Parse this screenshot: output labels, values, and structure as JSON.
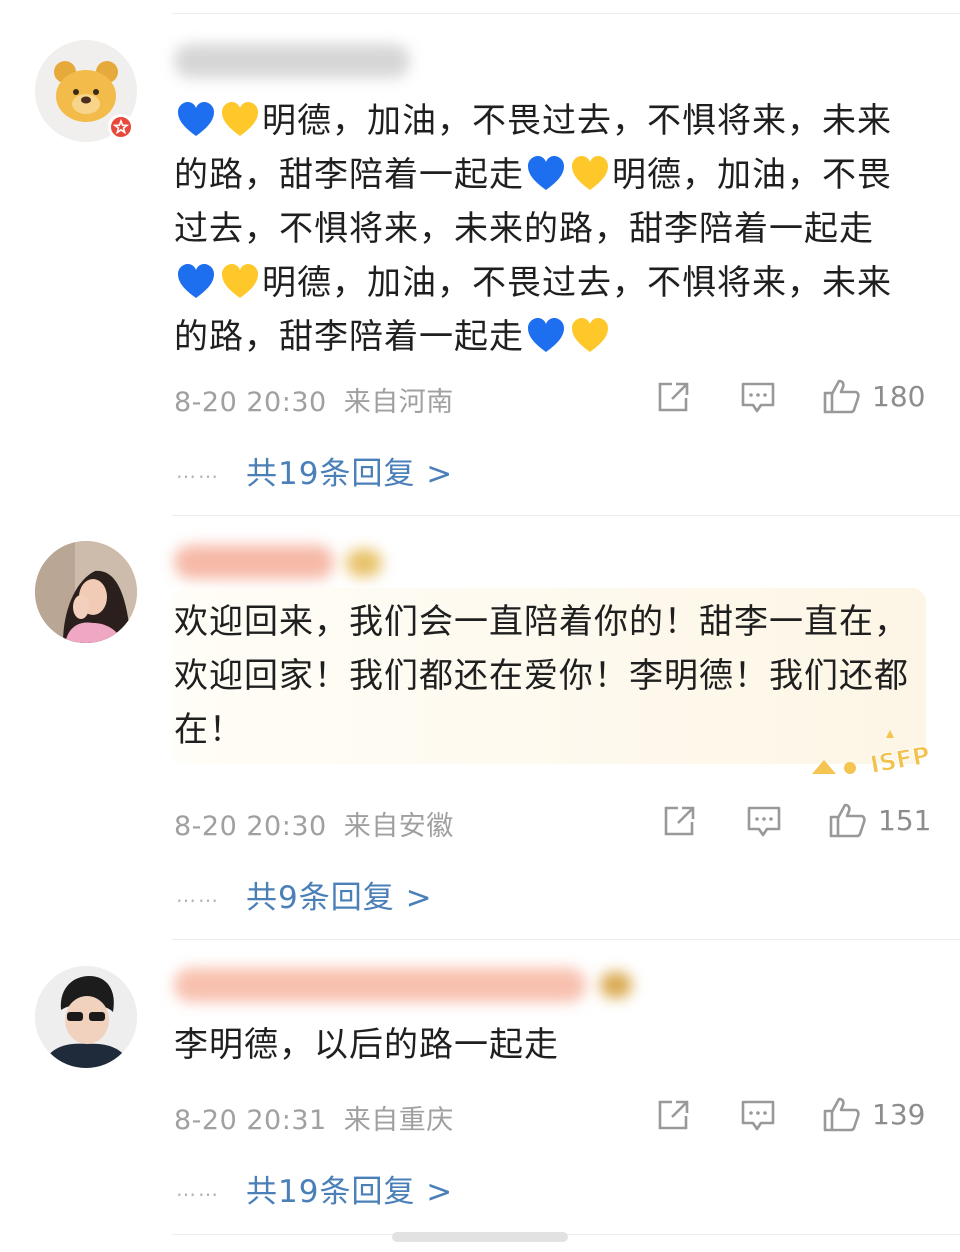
{
  "comments": [
    {
      "text_parts": [
        "明德，加油，不畏过去，不惧将来，未来的路，甜李陪着一起走",
        "明德，加油，不畏过去，不惧将来，未来的路，甜李陪着一起走",
        "明德，加油，不畏过去，不惧将来，未来的路，甜李陪着一起走"
      ],
      "time": "8-20 20:30",
      "location": "来自河南",
      "likes": "180",
      "replies": "共19条回复 >",
      "dots": "……"
    },
    {
      "text": "欢迎回来，我们会一直陪着你的！甜李一直在，欢迎回家！我们都还在爱你！李明德！我们还都在！",
      "time": "8-20 20:30",
      "location": "来自安徽",
      "likes": "151",
      "replies": "共9条回复 >",
      "dots": "……"
    },
    {
      "text": "李明德，以后的路一起走",
      "time": "8-20 20:31",
      "location": "来自重庆",
      "likes": "139",
      "replies": "共19条回复 >",
      "dots": "……"
    }
  ],
  "card_sticker": "ISFP",
  "colors": {
    "blue_heart": "#1e6ff0",
    "yellow_heart": "#ffc82a",
    "link": "#4a7fb8",
    "meta": "#a0a0a0"
  }
}
